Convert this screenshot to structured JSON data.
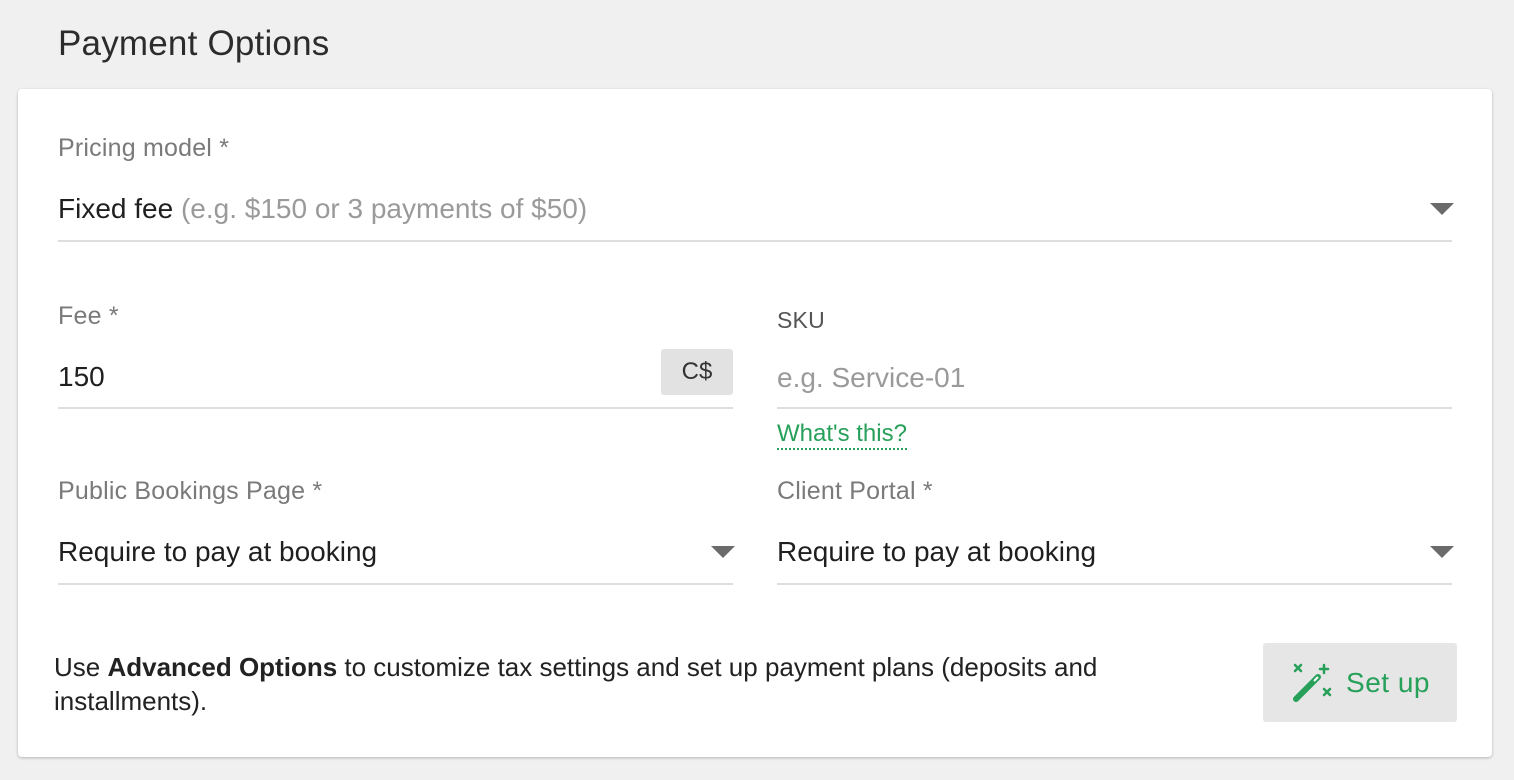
{
  "section": {
    "title": "Payment Options"
  },
  "pricing_model": {
    "label": "Pricing model *",
    "value": "Fixed fee",
    "hint": "(e.g. $150 or 3 payments of $50)"
  },
  "fee": {
    "label": "Fee *",
    "value": "150",
    "currency": "C$"
  },
  "sku": {
    "label": "SKU",
    "placeholder": "e.g. Service-01",
    "help_link": "What's this?"
  },
  "public_bookings": {
    "label": "Public Bookings Page *",
    "value": "Require to pay at booking"
  },
  "client_portal": {
    "label": "Client Portal *",
    "value": "Require to pay at booking"
  },
  "advanced": {
    "prefix": "Use ",
    "bold": "Advanced Options",
    "suffix": " to customize tax settings and set up payment plans (deposits and installments).",
    "button_label": "Set up",
    "button_icon": "magic-wand-icon"
  },
  "colors": {
    "accent_green": "#27a05a",
    "background": "#f0f0f0",
    "card": "#ffffff"
  }
}
